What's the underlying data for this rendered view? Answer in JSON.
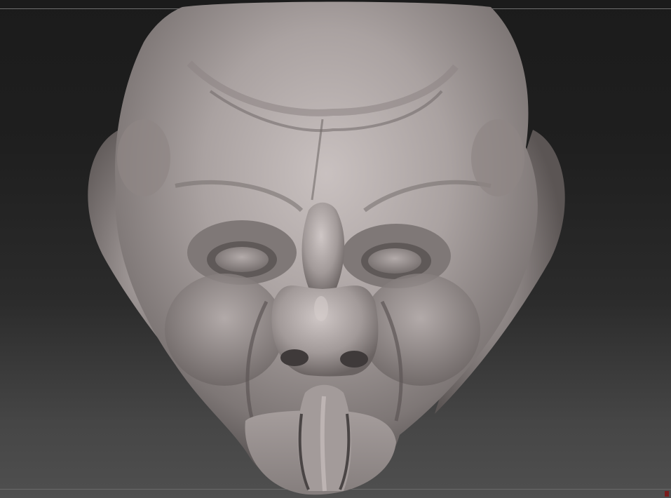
{
  "viewport": {
    "background_top": "#1b1b1b",
    "background_bottom": "#4f4f4f",
    "guide_line_color": "#6e6e6e",
    "corner_marker_color": "#7a1c1c"
  },
  "model": {
    "material_color": "#a8a1a0",
    "shadow_color": "#4a4545",
    "highlight_color": "#d9d2d1"
  }
}
